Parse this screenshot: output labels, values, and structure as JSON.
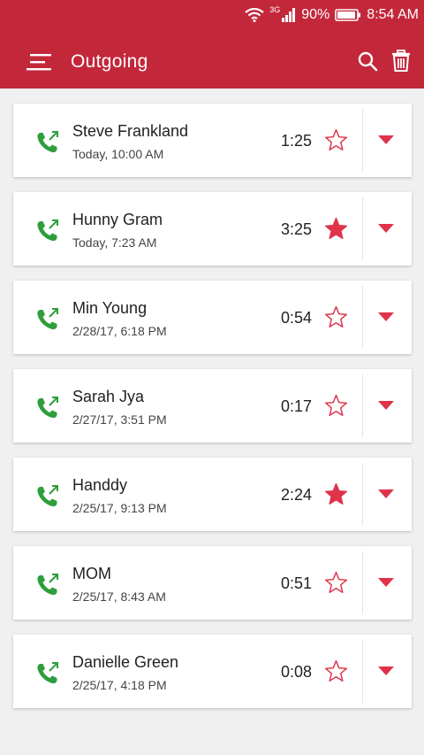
{
  "status_bar": {
    "network": "3G",
    "battery": "90%",
    "time": "8:54 AM"
  },
  "app_bar": {
    "title": "Outgoing",
    "menu_icon": "hamburger-menu-icon",
    "search_icon": "search-icon",
    "delete_icon": "trash-icon"
  },
  "colors": {
    "primary": "#c3283a",
    "call_icon": "#2e9e3c",
    "star": "#e0334a"
  },
  "calls": [
    {
      "name": "Steve Frankland",
      "time": "Today, 10:00 AM",
      "duration": "1:25",
      "starred": false
    },
    {
      "name": "Hunny Gram",
      "time": "Today, 7:23 AM",
      "duration": "3:25",
      "starred": true
    },
    {
      "name": "Min Young",
      "time": "2/28/17, 6:18 PM",
      "duration": "0:54",
      "starred": false
    },
    {
      "name": "Sarah Jya",
      "time": "2/27/17, 3:51 PM",
      "duration": "0:17",
      "starred": false
    },
    {
      "name": "Handdy",
      "time": "2/25/17, 9:13 PM",
      "duration": "2:24",
      "starred": true
    },
    {
      "name": "MOM",
      "time": "2/25/17, 8:43 AM",
      "duration": "0:51",
      "starred": false
    },
    {
      "name": "Danielle Green",
      "time": "2/25/17, 4:18 PM",
      "duration": "0:08",
      "starred": false
    }
  ]
}
